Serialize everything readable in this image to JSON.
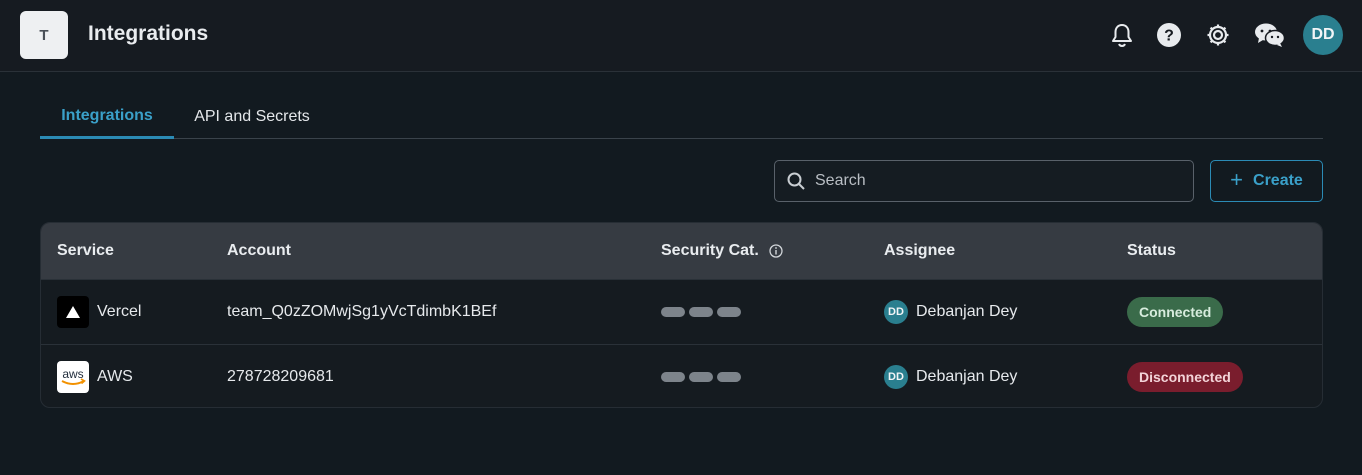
{
  "header": {
    "logo_letter": "T",
    "title": "Integrations",
    "avatar": "DD"
  },
  "tabs": [
    {
      "label": "Integrations",
      "active": true
    },
    {
      "label": "API and Secrets",
      "active": false
    }
  ],
  "search": {
    "placeholder": "Search",
    "value": ""
  },
  "create_button": {
    "label": "Create",
    "icon": "plus-icon"
  },
  "table": {
    "columns": [
      "Service",
      "Account",
      "Security Cat.",
      "Assignee",
      "Status"
    ],
    "rows": [
      {
        "service": "Vercel",
        "service_icon": "vercel-logo",
        "account": "team_Q0zZOMwjSg1yVcTdimbK1BEf",
        "assignee_initials": "DD",
        "assignee": "Debanjan Dey",
        "status": "Connected"
      },
      {
        "service": "AWS",
        "service_icon": "aws-logo",
        "account": "278728209681",
        "assignee_initials": "DD",
        "assignee": "Debanjan Dey",
        "status": "Disconnected"
      }
    ]
  },
  "colors": {
    "accent": "#2b8bb5",
    "connected": "#3a6b4a",
    "disconnected": "#7a1d2d",
    "avatar": "#2a7f8f"
  }
}
